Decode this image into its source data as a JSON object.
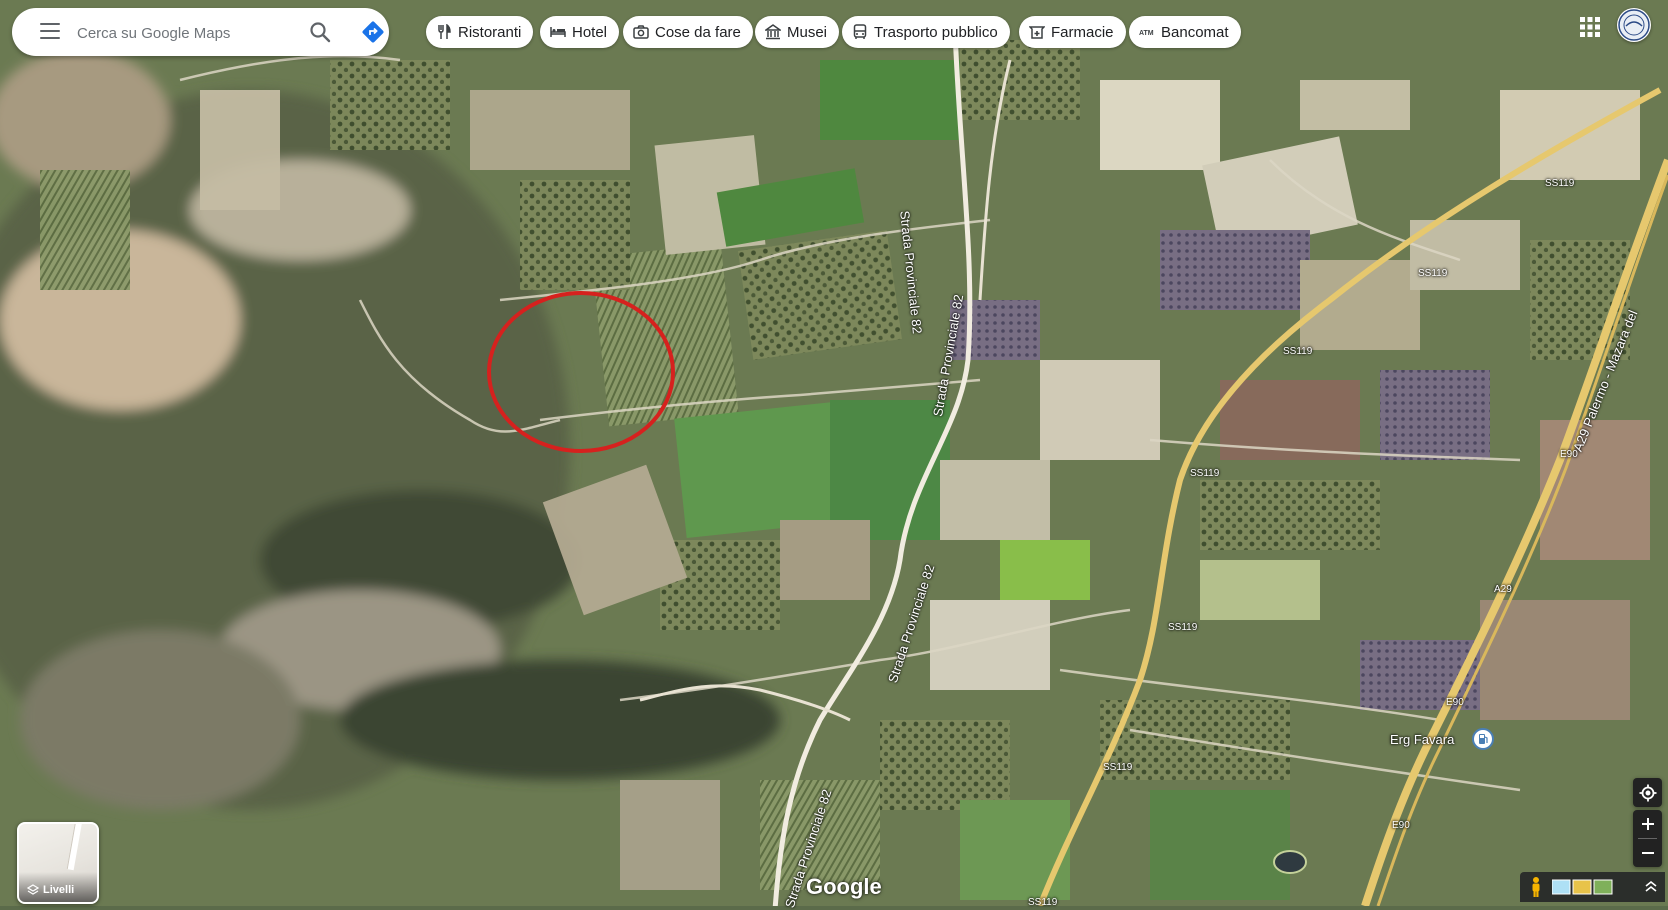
{
  "search": {
    "placeholder": "Cerca su Google Maps"
  },
  "chips": [
    {
      "label": "Ristoranti",
      "icon": "fork-knife-icon"
    },
    {
      "label": "Hotel",
      "icon": "bed-icon"
    },
    {
      "label": "Cose da fare",
      "icon": "camera-icon"
    },
    {
      "label": "Musei",
      "icon": "museum-icon"
    },
    {
      "label": "Trasporto pubblico",
      "icon": "bus-icon"
    },
    {
      "label": "Farmacie",
      "icon": "pharmacy-icon"
    },
    {
      "label": "Bancomat",
      "icon": "atm-icon"
    }
  ],
  "layers": {
    "label": "Livelli"
  },
  "map": {
    "road_labels": {
      "sp82": "Strada Provinciale 82",
      "ss119": "SS119",
      "a29": "A29 Palermo - Mazara del",
      "a29_short": "A29",
      "e90": "E90"
    },
    "poi": {
      "name": "Erg Favara"
    }
  },
  "footer": {
    "logo": "Google"
  },
  "colors": {
    "highlight_circle": "#d6211e",
    "directions_blue": "#1a73e8",
    "motorway": "#e8c770",
    "road_white": "#f7f3ea"
  }
}
